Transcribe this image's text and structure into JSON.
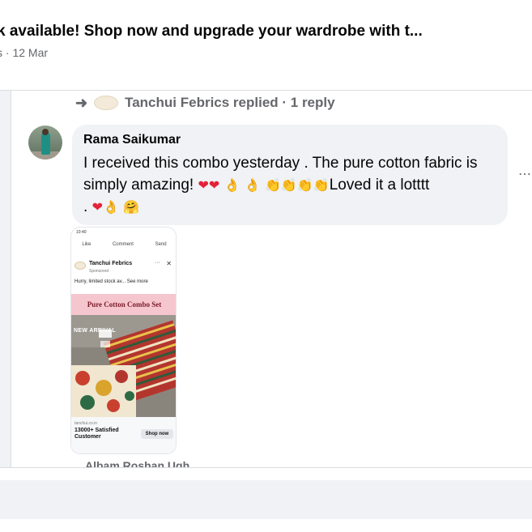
{
  "post": {
    "title": "k available! Shop now and upgrade your wardrobe with t...",
    "meta": "s · 12 Mar"
  },
  "reply_summary": {
    "arrow": "➜",
    "text": "Tanchui Febrics replied · 1 reply"
  },
  "comment": {
    "author": "Rama Saikumar",
    "text_part1": "I received this combo yesterday . The pure cotton fabric is simply amazing! ",
    "text_part2": "Loved it a lotttt",
    "text_part3": ". ",
    "more": "⋯"
  },
  "attachment": {
    "status_time": "10:40",
    "actions": [
      "Like",
      "Comment",
      "Send"
    ],
    "page_name": "Tanchui Febrics",
    "sponsored": "Sponsored · ",
    "caption": "Hurry, limited stock av... See more",
    "banner": "Pure Cotton Combo Set",
    "new_arrival": "NEW ARRIVAL",
    "url": "tanchui.co.in",
    "tagline": "13000+ Satisfied Customer",
    "cta": "Shop now"
  },
  "next_reply": "Albam Roshan Ugh",
  "colors": {
    "heart": "#e4223a",
    "emoji_yellow": "#f3b52a",
    "bubble": "#f0f2f5",
    "banner_pink": "#f6c6ce"
  }
}
